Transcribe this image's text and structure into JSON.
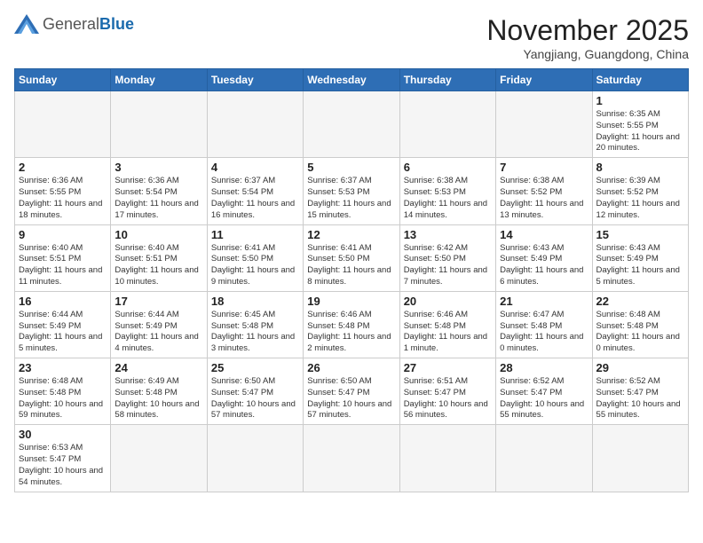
{
  "header": {
    "logo": {
      "general": "General",
      "blue": "Blue"
    },
    "title": "November 2025",
    "subtitle": "Yangjiang, Guangdong, China"
  },
  "weekdays": [
    "Sunday",
    "Monday",
    "Tuesday",
    "Wednesday",
    "Thursday",
    "Friday",
    "Saturday"
  ],
  "weeks": [
    [
      {
        "day": "",
        "info": ""
      },
      {
        "day": "",
        "info": ""
      },
      {
        "day": "",
        "info": ""
      },
      {
        "day": "",
        "info": ""
      },
      {
        "day": "",
        "info": ""
      },
      {
        "day": "",
        "info": ""
      },
      {
        "day": "1",
        "info": "Sunrise: 6:35 AM\nSunset: 5:55 PM\nDaylight: 11 hours and 20 minutes."
      }
    ],
    [
      {
        "day": "2",
        "info": "Sunrise: 6:36 AM\nSunset: 5:55 PM\nDaylight: 11 hours and 18 minutes."
      },
      {
        "day": "3",
        "info": "Sunrise: 6:36 AM\nSunset: 5:54 PM\nDaylight: 11 hours and 17 minutes."
      },
      {
        "day": "4",
        "info": "Sunrise: 6:37 AM\nSunset: 5:54 PM\nDaylight: 11 hours and 16 minutes."
      },
      {
        "day": "5",
        "info": "Sunrise: 6:37 AM\nSunset: 5:53 PM\nDaylight: 11 hours and 15 minutes."
      },
      {
        "day": "6",
        "info": "Sunrise: 6:38 AM\nSunset: 5:53 PM\nDaylight: 11 hours and 14 minutes."
      },
      {
        "day": "7",
        "info": "Sunrise: 6:38 AM\nSunset: 5:52 PM\nDaylight: 11 hours and 13 minutes."
      },
      {
        "day": "8",
        "info": "Sunrise: 6:39 AM\nSunset: 5:52 PM\nDaylight: 11 hours and 12 minutes."
      }
    ],
    [
      {
        "day": "9",
        "info": "Sunrise: 6:40 AM\nSunset: 5:51 PM\nDaylight: 11 hours and 11 minutes."
      },
      {
        "day": "10",
        "info": "Sunrise: 6:40 AM\nSunset: 5:51 PM\nDaylight: 11 hours and 10 minutes."
      },
      {
        "day": "11",
        "info": "Sunrise: 6:41 AM\nSunset: 5:50 PM\nDaylight: 11 hours and 9 minutes."
      },
      {
        "day": "12",
        "info": "Sunrise: 6:41 AM\nSunset: 5:50 PM\nDaylight: 11 hours and 8 minutes."
      },
      {
        "day": "13",
        "info": "Sunrise: 6:42 AM\nSunset: 5:50 PM\nDaylight: 11 hours and 7 minutes."
      },
      {
        "day": "14",
        "info": "Sunrise: 6:43 AM\nSunset: 5:49 PM\nDaylight: 11 hours and 6 minutes."
      },
      {
        "day": "15",
        "info": "Sunrise: 6:43 AM\nSunset: 5:49 PM\nDaylight: 11 hours and 5 minutes."
      }
    ],
    [
      {
        "day": "16",
        "info": "Sunrise: 6:44 AM\nSunset: 5:49 PM\nDaylight: 11 hours and 5 minutes."
      },
      {
        "day": "17",
        "info": "Sunrise: 6:44 AM\nSunset: 5:49 PM\nDaylight: 11 hours and 4 minutes."
      },
      {
        "day": "18",
        "info": "Sunrise: 6:45 AM\nSunset: 5:48 PM\nDaylight: 11 hours and 3 minutes."
      },
      {
        "day": "19",
        "info": "Sunrise: 6:46 AM\nSunset: 5:48 PM\nDaylight: 11 hours and 2 minutes."
      },
      {
        "day": "20",
        "info": "Sunrise: 6:46 AM\nSunset: 5:48 PM\nDaylight: 11 hours and 1 minute."
      },
      {
        "day": "21",
        "info": "Sunrise: 6:47 AM\nSunset: 5:48 PM\nDaylight: 11 hours and 0 minutes."
      },
      {
        "day": "22",
        "info": "Sunrise: 6:48 AM\nSunset: 5:48 PM\nDaylight: 11 hours and 0 minutes."
      }
    ],
    [
      {
        "day": "23",
        "info": "Sunrise: 6:48 AM\nSunset: 5:48 PM\nDaylight: 10 hours and 59 minutes."
      },
      {
        "day": "24",
        "info": "Sunrise: 6:49 AM\nSunset: 5:48 PM\nDaylight: 10 hours and 58 minutes."
      },
      {
        "day": "25",
        "info": "Sunrise: 6:50 AM\nSunset: 5:47 PM\nDaylight: 10 hours and 57 minutes."
      },
      {
        "day": "26",
        "info": "Sunrise: 6:50 AM\nSunset: 5:47 PM\nDaylight: 10 hours and 57 minutes."
      },
      {
        "day": "27",
        "info": "Sunrise: 6:51 AM\nSunset: 5:47 PM\nDaylight: 10 hours and 56 minutes."
      },
      {
        "day": "28",
        "info": "Sunrise: 6:52 AM\nSunset: 5:47 PM\nDaylight: 10 hours and 55 minutes."
      },
      {
        "day": "29",
        "info": "Sunrise: 6:52 AM\nSunset: 5:47 PM\nDaylight: 10 hours and 55 minutes."
      }
    ],
    [
      {
        "day": "30",
        "info": "Sunrise: 6:53 AM\nSunset: 5:47 PM\nDaylight: 10 hours and 54 minutes."
      },
      {
        "day": "",
        "info": ""
      },
      {
        "day": "",
        "info": ""
      },
      {
        "day": "",
        "info": ""
      },
      {
        "day": "",
        "info": ""
      },
      {
        "day": "",
        "info": ""
      },
      {
        "day": "",
        "info": ""
      }
    ]
  ]
}
